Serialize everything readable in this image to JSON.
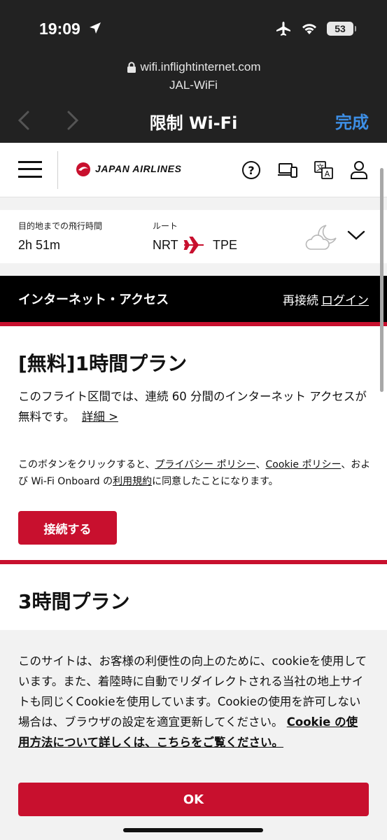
{
  "status": {
    "time": "19:09",
    "battery": "53"
  },
  "browser": {
    "url": "wifi.inflightinternet.com",
    "site_name": "JAL-WiFi",
    "title": "限制 Wi-Fi",
    "done_label": "完成"
  },
  "header": {
    "logo_text": "JAPAN AIRLINES",
    "brand_color": "#c8102e"
  },
  "flight": {
    "time_label": "目的地までの飛行時間",
    "time_value": "2h 51m",
    "route_label": "ルート",
    "origin": "NRT",
    "destination": "TPE"
  },
  "access_bar": {
    "title": "インターネット・アクセス",
    "reconnect": "再接続",
    "login": "ログイン"
  },
  "plan1": {
    "title": "[無料]1時間プラン",
    "description": "このフライト区間では、連続 60 分間のインターネット アクセスが無料です。",
    "details_link": "詳細 >",
    "terms_prefix": "このボタンをクリックすると、",
    "privacy_link": "プライバシー ポリシー",
    "sep": "、",
    "cookie_link": "Cookie ポリシー",
    "terms_middle": "、および Wi-Fi Onboard の",
    "tos_link": "利用規約",
    "terms_suffix": "に同意したことになります。",
    "connect_label": "接続する"
  },
  "plan2": {
    "title": "3時間プラン"
  },
  "cookie": {
    "text": "このサイトは、お客様の利便性の向上のために、cookieを使用しています。また、着陸時に自動でリダイレクトされる当社の地上サイトも同じくCookieを使用しています。Cookieの使用を許可しない場合は、ブラウザの設定を適宜更新してください。",
    "link": "Cookie の使用方法について詳しくは、こちらをご覧ください。",
    "ok_label": "OK"
  }
}
